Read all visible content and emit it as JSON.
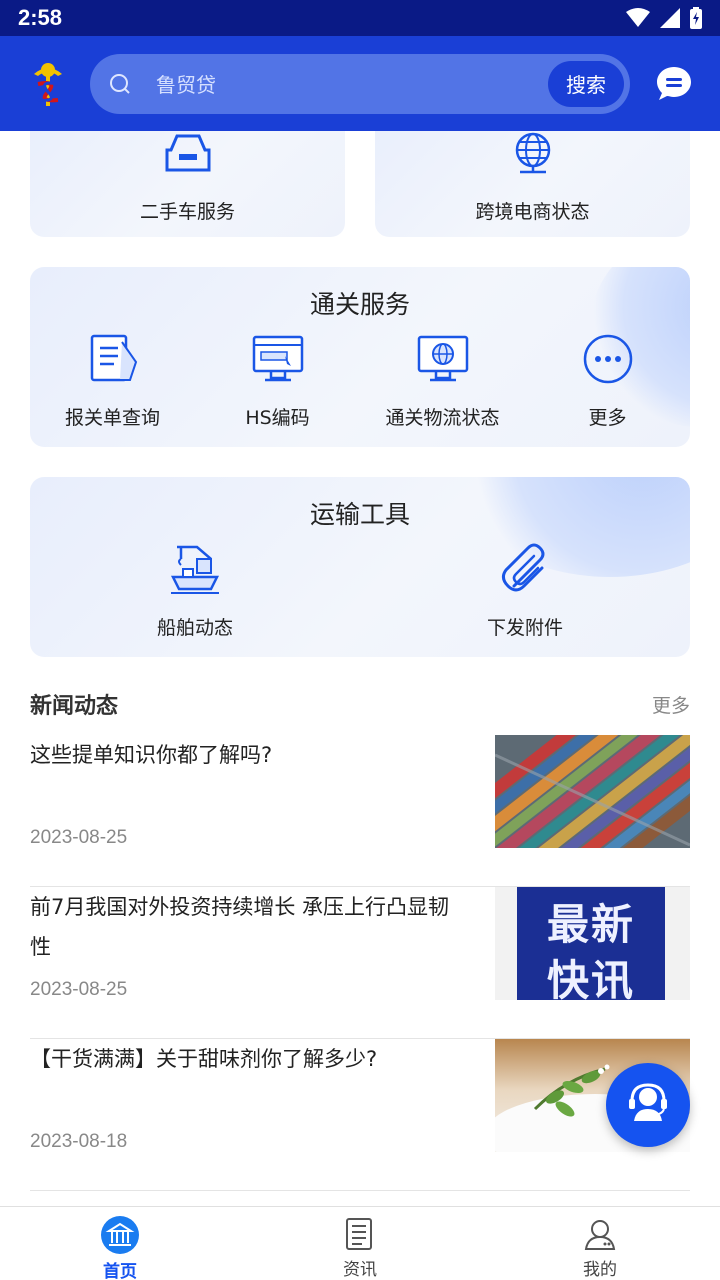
{
  "status_bar": {
    "time": "2:58"
  },
  "header": {
    "search_placeholder": "鲁贸贷",
    "search_button": "搜索"
  },
  "top_cards": [
    {
      "label": "二手车服务",
      "icon": "car-icon"
    },
    {
      "label": "跨境电商状态",
      "icon": "globe-network-icon"
    }
  ],
  "customs_section": {
    "title": "通关服务",
    "items": [
      {
        "label": "报关单查询",
        "icon": "document-icon"
      },
      {
        "label": "HS编码",
        "icon": "monitor-icon"
      },
      {
        "label": "通关物流状态",
        "icon": "monitor-globe-icon"
      },
      {
        "label": "更多",
        "icon": "more-icon"
      }
    ]
  },
  "transport_section": {
    "title": "运输工具",
    "items": [
      {
        "label": "船舶动态",
        "icon": "ship-crane-icon"
      },
      {
        "label": "下发附件",
        "icon": "paperclip-icon"
      }
    ]
  },
  "news": {
    "title": "新闻动态",
    "more": "更多",
    "items": [
      {
        "title": "这些提单知识你都了解吗?",
        "date": "2023-08-25",
        "thumb": "containers-image"
      },
      {
        "title": "前7月我国对外投资持续增长 承压上行凸显韧性",
        "date": "2023-08-25",
        "thumb": "newsflash-image",
        "thumb_text_1": "最新",
        "thumb_text_2": "快讯"
      },
      {
        "title": "【干货满满】关于甜味剂你了解多少?",
        "date": "2023-08-18",
        "thumb": "sweetener-image"
      }
    ]
  },
  "tab_bar": {
    "tabs": [
      {
        "label": "首页",
        "icon": "home-icon",
        "active": true
      },
      {
        "label": "资讯",
        "icon": "news-icon",
        "active": false
      },
      {
        "label": "我的",
        "icon": "profile-icon",
        "active": false
      }
    ]
  },
  "colors": {
    "status_bar": "#0a1a86",
    "header": "#1a3fd6",
    "accent": "#1553f0",
    "icon_blue": "#1a56e6"
  }
}
